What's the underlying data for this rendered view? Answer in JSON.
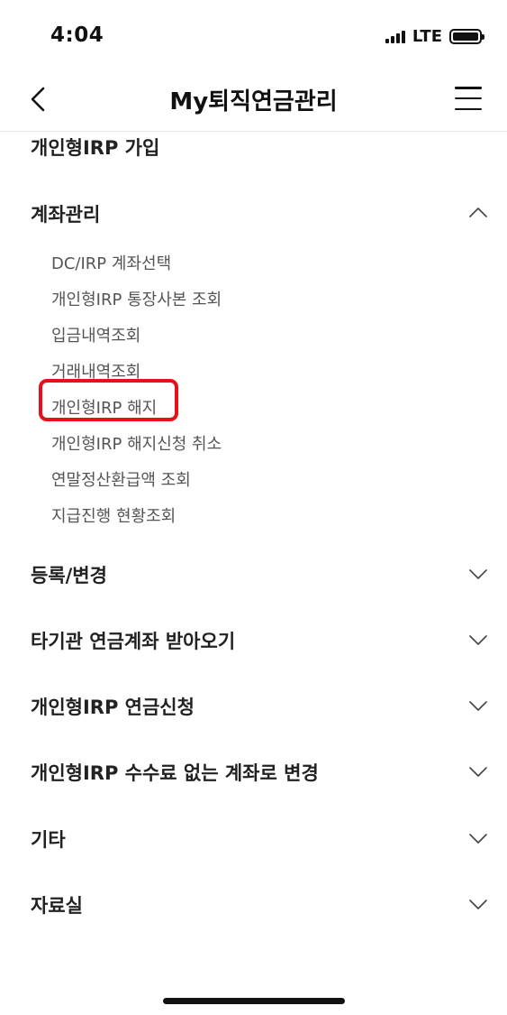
{
  "status_bar": {
    "time": "4:04",
    "network": "LTE"
  },
  "header": {
    "title": "My퇴직연금관리",
    "back_icon": "chevron-left-icon",
    "menu_icon": "hamburger-menu-icon"
  },
  "menu": {
    "partial_item": "개인형IRP 가입",
    "account_section": {
      "label": "계좌관리",
      "expanded": true,
      "items": [
        "DC/IRP 계좌선택",
        "개인형IRP 통장사본 조회",
        "입금내역조회",
        "거래내역조회",
        "개인형IRP 해지",
        "개인형IRP 해지신청 취소",
        "연말정산환급액 조회",
        "지급진행 현황조회"
      ]
    },
    "sections": [
      "등록/변경",
      "타기관 연금계좌 받아오기",
      "개인형IRP 연금신청",
      "개인형IRP 수수료 없는 계좌로 변경",
      "기타",
      "자료실"
    ]
  },
  "highlight_color": "#e8101a"
}
